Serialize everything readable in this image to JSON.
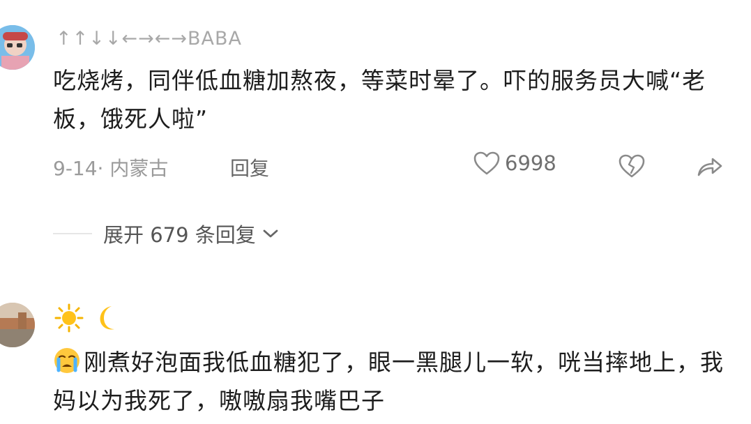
{
  "comments": [
    {
      "username": "↑↑↓↓←→←→BABA",
      "text": "吃烧烤，同伴低血糖加熬夜，等菜时晕了。吓的服务员大喊“老板，饿死人啦”",
      "date_location": "9-14· 内蒙古",
      "reply_label": "回复",
      "like_count": "6998",
      "expand_label": "展开 679 条回复"
    },
    {
      "username_icons": [
        "sun-emoji",
        "crescent-moon-emoji"
      ],
      "leading_emoji": "crying-face-emoji",
      "text": "刚煮好泡面我低血糖犯了，眼一黑腿儿一软，咣当摔地上，我妈以为我死了，嗷嗷扇我嘴巴子"
    }
  ],
  "icons": {
    "like": "heart-outline-icon",
    "dislike": "broken-heart-icon",
    "share": "share-arrow-icon",
    "expand": "chevron-down-icon"
  },
  "colors": {
    "text_primary": "#1d1d1d",
    "text_secondary": "#9a9a9a",
    "username": "#a8a8a8",
    "background": "#ffffff"
  }
}
